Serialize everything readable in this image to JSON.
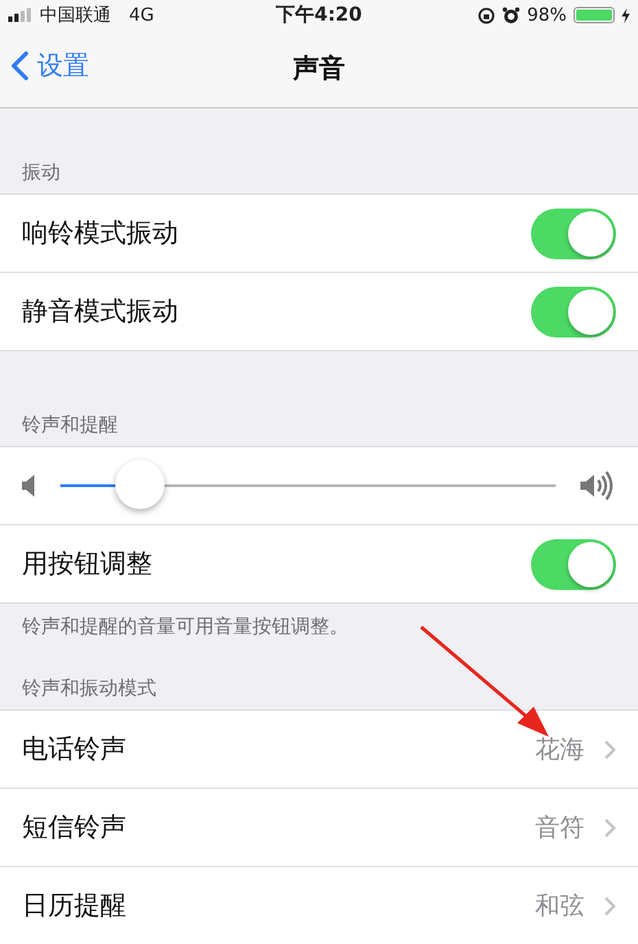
{
  "status_bar": {
    "carrier": "中国联通",
    "network": "4G",
    "time": "下午4:20",
    "battery": "98%"
  },
  "nav": {
    "back": "设置",
    "title": "声音"
  },
  "sections": [
    {
      "header": "振动",
      "rows": [
        {
          "kind": "toggle",
          "label": "响铃模式振动",
          "on": true
        },
        {
          "kind": "toggle",
          "label": "静音模式振动",
          "on": true
        }
      ]
    },
    {
      "header": "铃声和提醒",
      "rows": [
        {
          "kind": "slider",
          "level": 0.16
        },
        {
          "kind": "toggle",
          "label": "用按钮调整",
          "on": true
        }
      ],
      "footer": "铃声和提醒的音量可用音量按钮调整。"
    },
    {
      "header": "铃声和振动模式",
      "rows": [
        {
          "kind": "link",
          "label": "电话铃声",
          "value": "花海"
        },
        {
          "kind": "link",
          "label": "短信铃声",
          "value": "音符"
        },
        {
          "kind": "link",
          "label": "日历提醒",
          "value": "和弦"
        }
      ]
    }
  ]
}
